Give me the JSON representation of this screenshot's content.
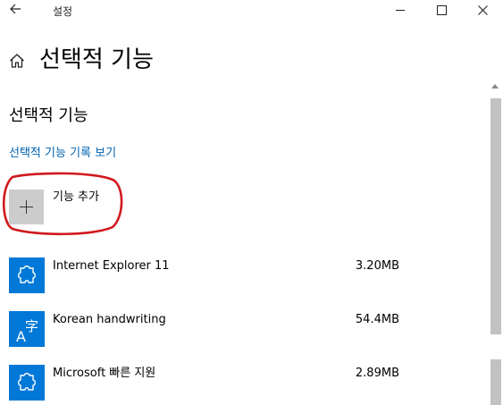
{
  "window": {
    "title": "설정",
    "back_icon": "back-arrow-icon",
    "controls": [
      "minimize-icon",
      "maximize-icon",
      "close-icon"
    ]
  },
  "page": {
    "title": "선택적 기능",
    "home_icon": "home-icon"
  },
  "section": {
    "title": "선택적 기능",
    "history_link": "선택적 기능 기록 보기",
    "add_feature_label": "기능 추가"
  },
  "features": [
    {
      "name": "Internet Explorer 11",
      "size": "3.20MB",
      "icon": "puzzle-icon"
    },
    {
      "name": "Korean handwriting",
      "size": "54.4MB",
      "icon": "handwriting-icon"
    },
    {
      "name": "Microsoft 빠른 지원",
      "size": "2.89MB",
      "icon": "puzzle-icon"
    }
  ],
  "colors": {
    "accent": "#0078d7",
    "link": "#0063b1",
    "annotation": "#d0191f"
  }
}
